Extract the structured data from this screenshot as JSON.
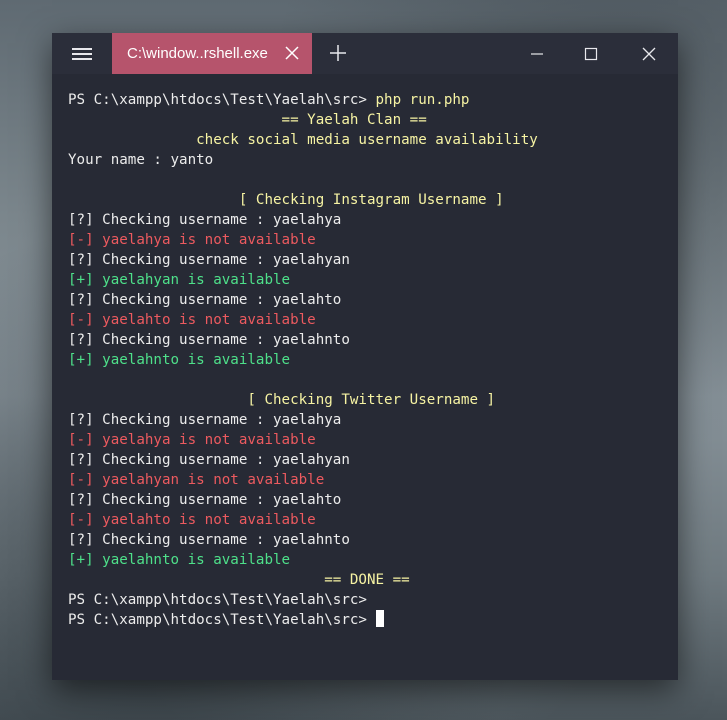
{
  "window": {
    "tab_title": "C:\\window..rshell.exe",
    "icons": {
      "menu": "hamburger-menu-icon",
      "tab_close": "close-icon",
      "new_tab": "plus-icon",
      "minimize": "minimize-icon",
      "maximize": "maximize-icon",
      "close": "close-icon"
    }
  },
  "colors": {
    "titlebar": "#2b2e3a",
    "tab": "#b6546c",
    "terminal_bg": "#272a35",
    "text": "#ececec",
    "yellow": "#f6f3a3",
    "red": "#ec5a5f",
    "green": "#4ee08a"
  },
  "terminal": {
    "lines": [
      {
        "text": "PS C:\\xampp\\htdocs\\Test\\Yaelah\\src> ",
        "suffix": "php run.php",
        "style": "prompt"
      },
      {
        "text": "                         == Yaelah Clan ==",
        "style": "yellow"
      },
      {
        "text": "               check social media username availability",
        "style": "yellow"
      },
      {
        "text": "Your name : yanto",
        "style": "plain"
      },
      {
        "text": "",
        "style": "plain"
      },
      {
        "text": "                    [ Checking Instagram Username ]",
        "style": "yellow"
      },
      {
        "text": "[?] Checking username : yaelahya",
        "style": "plain"
      },
      {
        "text": "[-] yaelahya is not available",
        "style": "red"
      },
      {
        "text": "[?] Checking username : yaelahyan",
        "style": "plain"
      },
      {
        "text": "[+] yaelahyan is available",
        "style": "green"
      },
      {
        "text": "[?] Checking username : yaelahto",
        "style": "plain"
      },
      {
        "text": "[-] yaelahto is not available",
        "style": "red"
      },
      {
        "text": "[?] Checking username : yaelahnto",
        "style": "plain"
      },
      {
        "text": "[+] yaelahnto is available",
        "style": "green"
      },
      {
        "text": "",
        "style": "plain"
      },
      {
        "text": "                     [ Checking Twitter Username ]",
        "style": "yellow"
      },
      {
        "text": "[?] Checking username : yaelahya",
        "style": "plain"
      },
      {
        "text": "[-] yaelahya is not available",
        "style": "red"
      },
      {
        "text": "[?] Checking username : yaelahyan",
        "style": "plain"
      },
      {
        "text": "[-] yaelahyan is not available",
        "style": "red"
      },
      {
        "text": "[?] Checking username : yaelahto",
        "style": "plain"
      },
      {
        "text": "[-] yaelahto is not available",
        "style": "red"
      },
      {
        "text": "[?] Checking username : yaelahnto",
        "style": "plain"
      },
      {
        "text": "[+] yaelahnto is available",
        "style": "green"
      },
      {
        "text": "                              == DONE ==",
        "style": "yellow"
      },
      {
        "text": "PS C:\\xampp\\htdocs\\Test\\Yaelah\\src>",
        "style": "plain"
      },
      {
        "text": "PS C:\\xampp\\htdocs\\Test\\Yaelah\\src> ",
        "style": "cursor"
      }
    ]
  }
}
